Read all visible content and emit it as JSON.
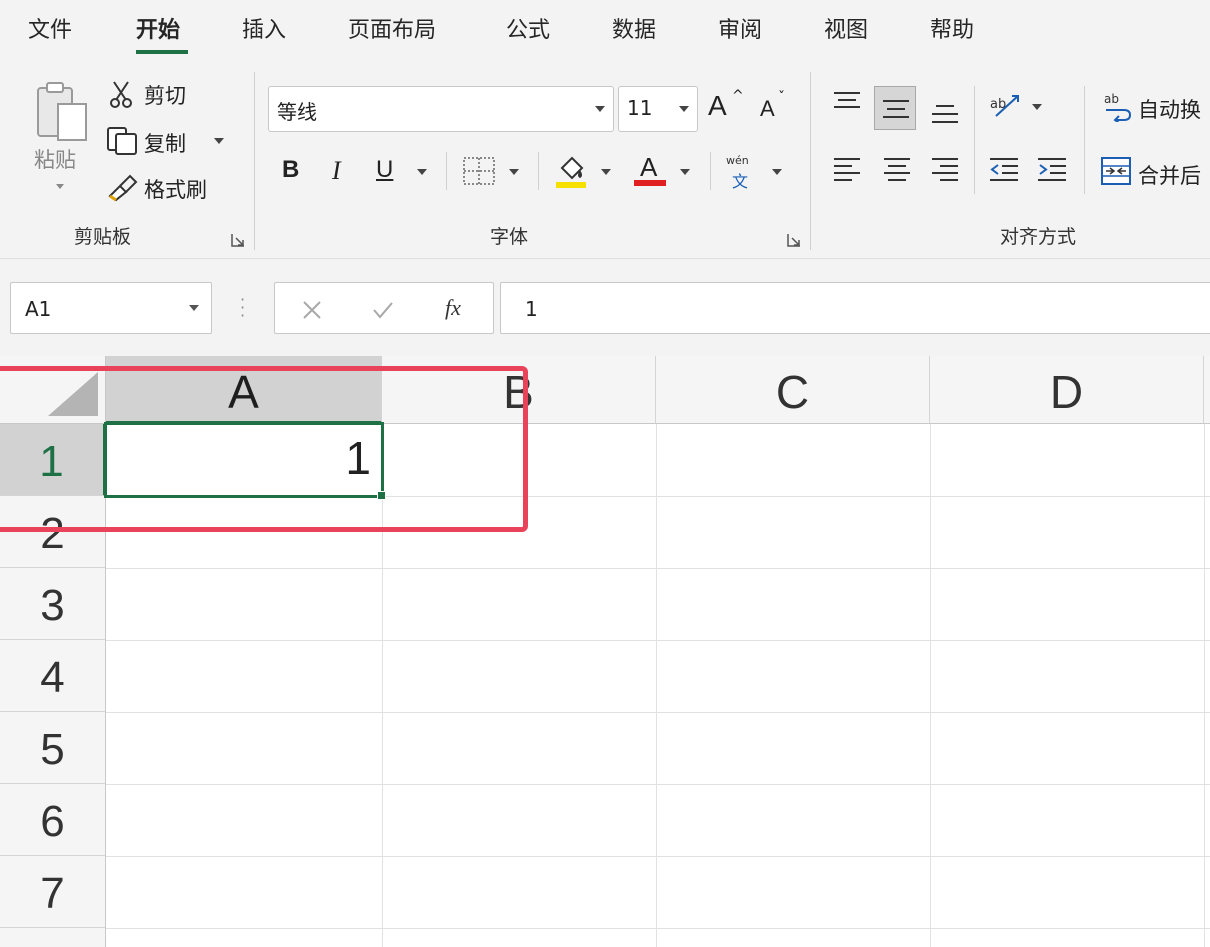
{
  "menu": {
    "tabs": [
      {
        "label": "文件"
      },
      {
        "label": "开始"
      },
      {
        "label": "插入"
      },
      {
        "label": "页面布局"
      },
      {
        "label": "公式"
      },
      {
        "label": "数据"
      },
      {
        "label": "审阅"
      },
      {
        "label": "视图"
      },
      {
        "label": "帮助"
      }
    ],
    "active_tab": "开始"
  },
  "clipboard": {
    "paste_label": "粘贴",
    "cut_label": "剪切",
    "copy_label": "复制",
    "format_painter_label": "格式刷",
    "group_label": "剪贴板"
  },
  "font": {
    "family": "等线",
    "size": "11",
    "grow_label": "A",
    "shrink_label": "A",
    "bold_label": "B",
    "italic_label": "I",
    "underline_label": "U",
    "font_color_label": "A",
    "phonetic_top": "wén",
    "phonetic_bottom": "文",
    "group_label": "字体",
    "fill_color": "#f5e000",
    "font_color": "#e02020"
  },
  "alignment": {
    "wrap_text_label": "自动换",
    "merge_label": "合并后",
    "group_label": "对齐方式"
  },
  "formula_bar": {
    "name_box": "A1",
    "fx_label": "fx",
    "content": "1"
  },
  "sheet": {
    "columns": [
      "A",
      "B",
      "C",
      "D"
    ],
    "rows": [
      "1",
      "2",
      "3",
      "4",
      "5",
      "6",
      "7"
    ],
    "cell_a1": "1",
    "accent": "#1e7145",
    "highlight": "#e8435a"
  }
}
